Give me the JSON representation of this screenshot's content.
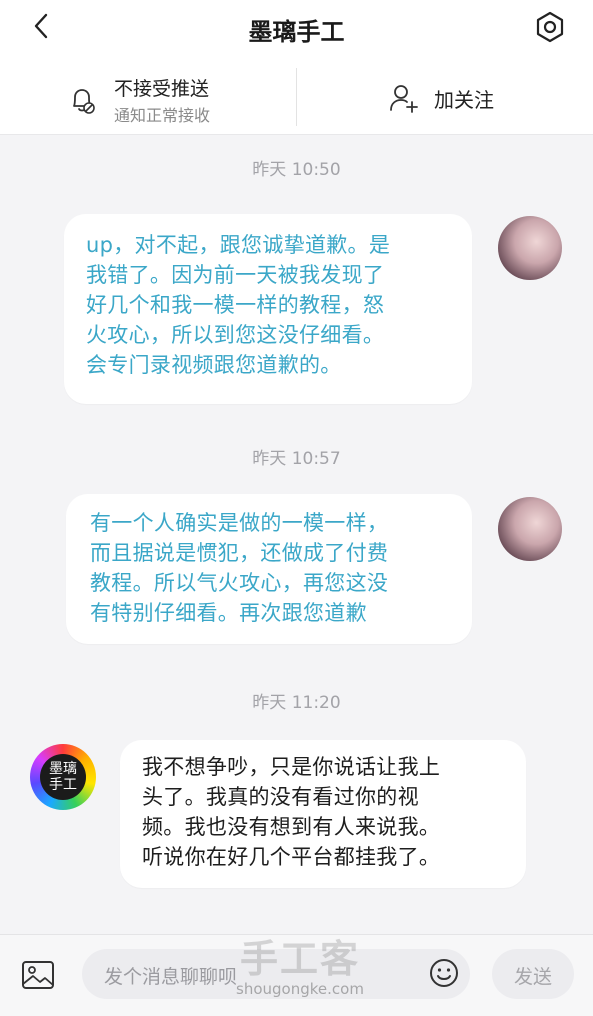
{
  "header": {
    "title": "墨璃手工"
  },
  "notify": {
    "main": "不接受推送",
    "sub": "通知正常接收",
    "follow": "加关注"
  },
  "messages": [
    {
      "time": "昨天 10:50",
      "side": "right",
      "lines": [
        "up，对不起，跟您诚挚道歉。是",
        "我错了。因为前一天被我发现了",
        "好几个和我一模一样的教程，怒",
        "火攻心，所以到您这没仔细看。",
        "会专门录视频跟您道歉的。"
      ]
    },
    {
      "time": "昨天 10:57",
      "side": "right",
      "lines": [
        "有一个人确实是做的一模一样，",
        "而且据说是惯犯，还做成了付费",
        "教程。所以气火攻心，再您这没",
        "有特别仔细看。再次跟您道歉"
      ]
    },
    {
      "time": "昨天 11:20",
      "side": "left",
      "lines": [
        "我不想争吵，只是你说话让我上",
        "头了。我真的没有看过你的视",
        "频。我也没有想到有人来说我。",
        "听说你在好几个平台都挂我了。"
      ]
    }
  ],
  "avatar_left_text": [
    "墨璃",
    "手工"
  ],
  "input": {
    "placeholder": "发个消息聊聊呗",
    "send": "发送"
  },
  "watermark": {
    "logo": "手工客",
    "url": "shougongke.com"
  },
  "colors": {
    "right_text": "#3ba7c8",
    "left_text": "#1e1e1e",
    "background": "#f4f4f6"
  }
}
